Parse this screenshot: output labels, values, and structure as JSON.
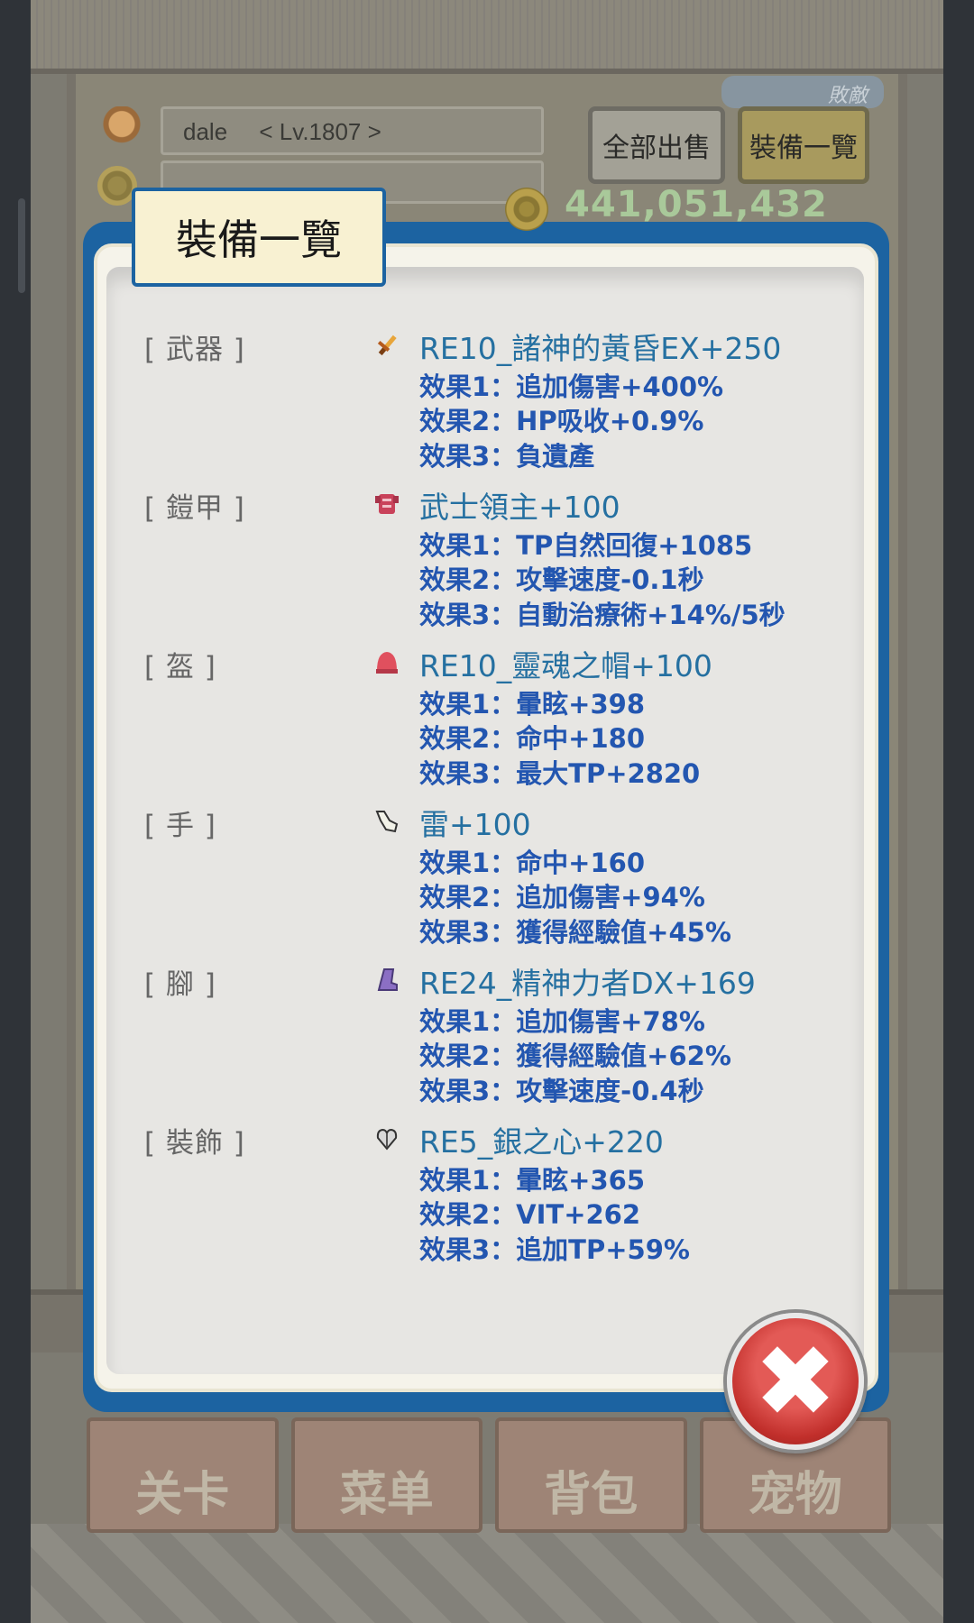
{
  "player": {
    "name": "dale",
    "level": "< Lv.1807 >"
  },
  "header": {
    "sell_all_label": "全部出售",
    "equip_list_label": "裝備一覽",
    "badge_label": "敗敵",
    "gold": "441,051,432"
  },
  "modal": {
    "title": "裝備一覽",
    "slots": [
      {
        "label": "[ 武器 ]",
        "icon": "sword-icon",
        "name": "RE10_諸神的黃昏EX+250",
        "effects": [
          "效果1：追加傷害+400%",
          "效果2：HP吸收+0.9%",
          "效果3：負遺產"
        ]
      },
      {
        "label": "[ 鎧甲 ]",
        "icon": "armor-icon",
        "name": "武士領主+100",
        "effects": [
          "效果1：TP自然回復+1085",
          "效果2：攻擊速度-0.1秒",
          "效果3：自動治療術+14%/5秒"
        ]
      },
      {
        "label": "[ 盔 ]",
        "icon": "helmet-icon",
        "name": "RE10_靈魂之帽+100",
        "effects": [
          "效果1：暈眩+398",
          "效果2：命中+180",
          "效果3：最大TP+2820"
        ]
      },
      {
        "label": "[ 手 ]",
        "icon": "glove-icon",
        "name": "雷+100",
        "effects": [
          "效果1：命中+160",
          "效果2：追加傷害+94%",
          "效果3：獲得經驗值+45%"
        ]
      },
      {
        "label": "[ 腳 ]",
        "icon": "boot-icon",
        "name": "RE24_精神力者DX+169",
        "effects": [
          "效果1：追加傷害+78%",
          "效果2：獲得經驗值+62%",
          "效果3：攻擊速度-0.4秒"
        ]
      },
      {
        "label": "[ 裝飾 ]",
        "icon": "heart-amulet-icon",
        "name": "RE5_銀之心+220",
        "effects": [
          "效果1：暈眩+365",
          "效果2：VIT+262",
          "效果3：追加TP+59%"
        ]
      }
    ]
  },
  "bottom_nav": {
    "stage": "关卡",
    "menu": "菜单",
    "bag": "背包",
    "pet": "宠物"
  },
  "colors": {
    "modal_border": "#1c63a1",
    "item_name": "#2570a1",
    "effect_text": "#2356b0",
    "close_red": "#c12f2b"
  }
}
